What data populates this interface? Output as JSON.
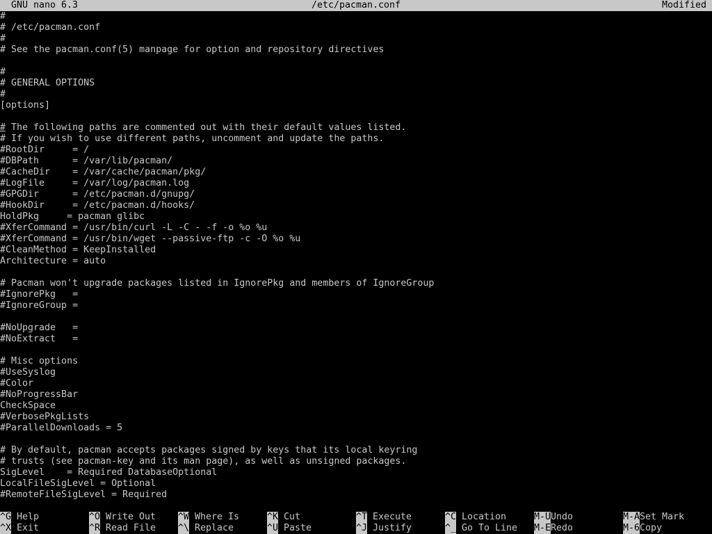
{
  "title_bar": {
    "app": "GNU nano 6.3",
    "filename": "/etc/pacman.conf",
    "status": "Modified"
  },
  "colors": {
    "background": "#000000",
    "foreground": "#c8c8c8",
    "bar_background": "#c8c8c8",
    "bar_foreground": "#000000"
  },
  "editor": {
    "cursor_line": 11,
    "lines": [
      "#",
      "# /etc/pacman.conf",
      "#",
      "# See the pacman.conf(5) manpage for option and repository directives",
      "",
      "#",
      "# GENERAL OPTIONS",
      "#",
      "[options]",
      "",
      "# The following paths are commented out with their default values listed.",
      "# If you wish to use different paths, uncomment and update the paths.",
      "#RootDir     = /",
      "#DBPath      = /var/lib/pacman/",
      "#CacheDir    = /var/cache/pacman/pkg/",
      "#LogFile     = /var/log/pacman.log",
      "#GPGDir      = /etc/pacman.d/gnupg/",
      "#HookDir     = /etc/pacman.d/hooks/",
      "HoldPkg     = pacman glibc",
      "#XferCommand = /usr/bin/curl -L -C - -f -o %o %u",
      "#XferCommand = /usr/bin/wget --passive-ftp -c -O %o %u",
      "#CleanMethod = KeepInstalled",
      "Architecture = auto",
      "",
      "# Pacman won't upgrade packages listed in IgnorePkg and members of IgnoreGroup",
      "#IgnorePkg   =",
      "#IgnoreGroup =",
      "",
      "#NoUpgrade   =",
      "#NoExtract   =",
      "",
      "# Misc options",
      "#UseSyslog",
      "#Color",
      "#NoProgressBar",
      "CheckSpace",
      "#VerbosePkgLists",
      "#ParallelDownloads = 5",
      "",
      "# By default, pacman accepts packages signed by keys that its local keyring",
      "# trusts (see pacman-key and its man page), as well as unsigned packages.",
      "SigLevel    = Required DatabaseOptional",
      "LocalFileSigLevel = Optional",
      "#RemoteFileSigLevel = Required"
    ]
  },
  "shortcuts": [
    {
      "key": "^G",
      "label": "Help"
    },
    {
      "key": "^X",
      "label": "Exit"
    },
    {
      "key": "^O",
      "label": "Write Out"
    },
    {
      "key": "^R",
      "label": "Read File"
    },
    {
      "key": "^W",
      "label": "Where Is"
    },
    {
      "key": "^\\",
      "label": "Replace"
    },
    {
      "key": "^K",
      "label": "Cut"
    },
    {
      "key": "^U",
      "label": "Paste"
    },
    {
      "key": "^T",
      "label": "Execute"
    },
    {
      "key": "^J",
      "label": "Justify"
    },
    {
      "key": "^C",
      "label": "Location"
    },
    {
      "key": "^_",
      "label": "Go To Line"
    },
    {
      "key": "M-U",
      "label": "Undo"
    },
    {
      "key": "M-E",
      "label": "Redo"
    },
    {
      "key": "M-A",
      "label": "Set Mark"
    },
    {
      "key": "M-6",
      "label": "Copy"
    }
  ]
}
